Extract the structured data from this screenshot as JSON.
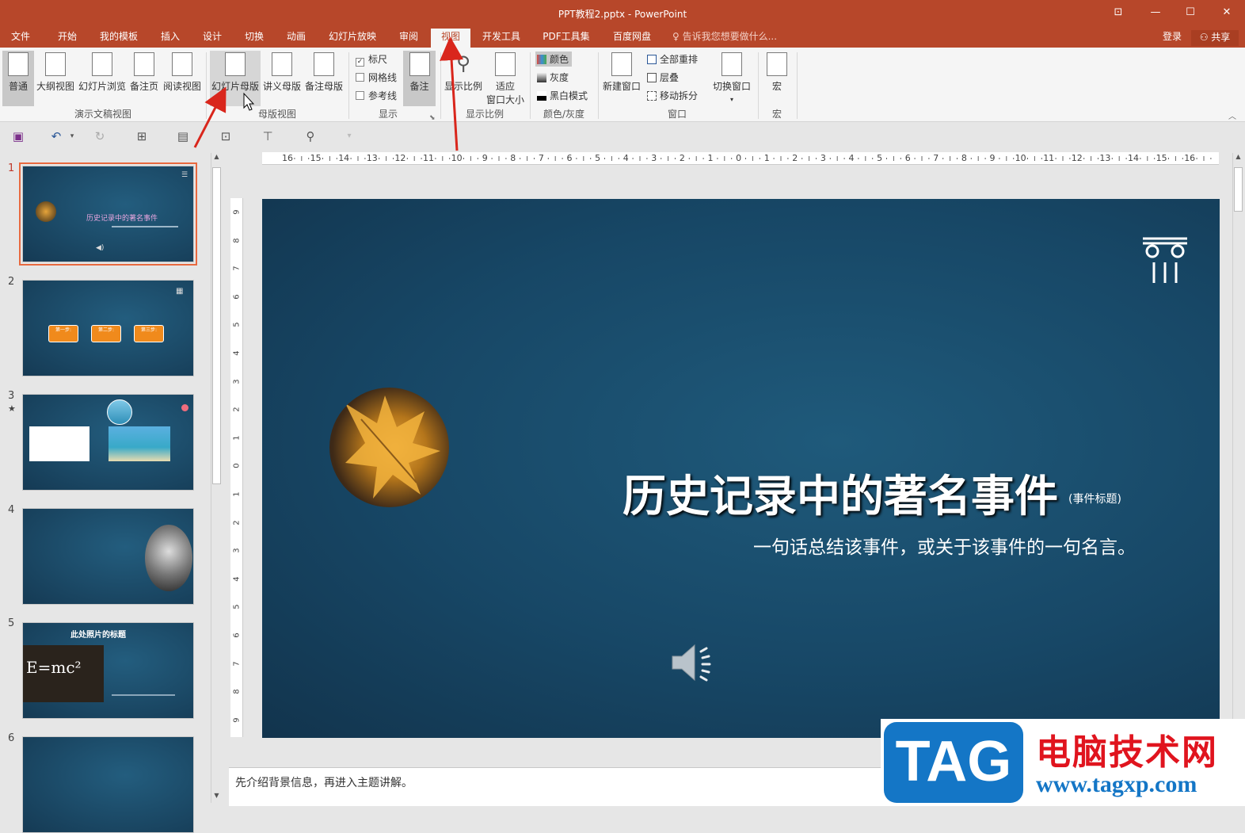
{
  "window": {
    "title": "PPT教程2.pptx - PowerPoint",
    "restore_icon": "ribbon-display-icon",
    "minimize": "—",
    "maximize": "☐",
    "close": "✕"
  },
  "menu": {
    "tabs": [
      "文件",
      "开始",
      "我的模板",
      "插入",
      "设计",
      "切换",
      "动画",
      "幻灯片放映",
      "审阅",
      "视图",
      "开发工具",
      "PDF工具集",
      "百度网盘"
    ],
    "active": "视图",
    "tell_me": "告诉我您想要做什么...",
    "login": "登录",
    "share": "共享"
  },
  "ribbon": {
    "presentation_views": {
      "buttons": [
        "普通",
        "大纲视图",
        "幻灯片浏览",
        "备注页",
        "阅读视图"
      ],
      "label": "演示文稿视图"
    },
    "master_views": {
      "buttons": [
        "幻灯片母版",
        "讲义母版",
        "备注母版"
      ],
      "label": "母版视图"
    },
    "show": {
      "items": [
        {
          "label": "标尺",
          "checked": true
        },
        {
          "label": "网格线",
          "checked": false
        },
        {
          "label": "参考线",
          "checked": false
        }
      ],
      "notes_button": "备注",
      "label": "显示"
    },
    "zoom": {
      "buttons": [
        "显示比例",
        "适应\n窗口大小"
      ],
      "zoom_label": "显示比例",
      "fit_line1": "适应",
      "fit_line2": "窗口大小",
      "label": "显示比例"
    },
    "color": {
      "items": [
        "颜色",
        "灰度",
        "黑白模式"
      ],
      "label": "颜色/灰度"
    },
    "window": {
      "new_window": "新建窗口",
      "items": [
        "全部重排",
        "层叠",
        "移动拆分"
      ],
      "switch_window": "切换窗口",
      "label": "窗口"
    },
    "macro": {
      "button": "宏",
      "label": "宏"
    }
  },
  "ruler": {
    "h_ticks": [
      "16",
      "15",
      "14",
      "13",
      "12",
      "11",
      "10",
      "9",
      "8",
      "7",
      "6",
      "5",
      "4",
      "3",
      "2",
      "1",
      "0",
      "1",
      "2",
      "3",
      "4",
      "5",
      "6",
      "7",
      "8",
      "9",
      "10",
      "11",
      "12",
      "13",
      "14",
      "15",
      "16"
    ],
    "v_ticks": [
      "9",
      "8",
      "7",
      "6",
      "5",
      "4",
      "3",
      "2",
      "1",
      "0",
      "1",
      "2",
      "3",
      "4",
      "5",
      "6",
      "7",
      "8",
      "9"
    ]
  },
  "thumbnails": [
    {
      "num": "1",
      "title": "历史记录中的著名事件",
      "active": true,
      "star": ""
    },
    {
      "num": "2",
      "steps": [
        "第一步:",
        "第二步:",
        "第三步:"
      ],
      "active": false,
      "star": ""
    },
    {
      "num": "3",
      "active": false,
      "star": "★"
    },
    {
      "num": "4",
      "active": false,
      "star": ""
    },
    {
      "num": "5",
      "title": "此处照片的标题",
      "formula": "E=mc²",
      "active": false,
      "star": ""
    },
    {
      "num": "6",
      "active": false,
      "star": ""
    }
  ],
  "slide": {
    "title": "历史记录中的著名事件",
    "tag": "(事件标题)",
    "subtitle": "一句话总结该事件，或关于该事件的一句名言。"
  },
  "notes": "先介绍背景信息，再进入主题讲解。",
  "watermark": {
    "tag": "TAG",
    "cn": "电脑技术网",
    "url": "www.tagxp.com"
  },
  "colors": {
    "accent": "#b7472a",
    "slide_bg": "#174766",
    "highlight": "#e8693f",
    "arrow": "#d9261c"
  }
}
